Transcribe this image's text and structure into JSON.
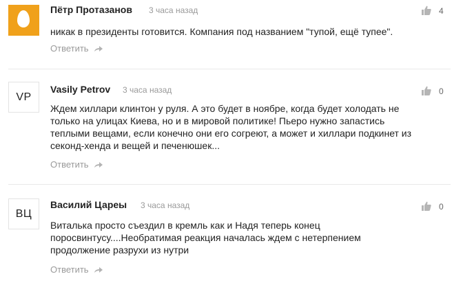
{
  "comments": [
    {
      "author": "Пётр Протазанов",
      "time": "3 часа назад",
      "text": "никак в президенты готовится. Компания под названием \"тупой, ещё тупее\".",
      "reply_label": "Ответить",
      "likes": "4",
      "avatar_type": "egg",
      "avatar_color": "#f0a11b"
    },
    {
      "author": "Vasily Petrov",
      "time": "3 часа назад",
      "text": "Ждем хиллари клинтон у руля. А это будет в ноябре, когда будет холодать не только на улицах Киева, но и в мировой политике! Пьеро нужно запастись теплыми вещами, если конечно они его согреют, а может и хиллари подкинет из секонд-хенда и вещей и печенюшек...",
      "reply_label": "Ответить",
      "likes": "0",
      "avatar_initials": "VP"
    },
    {
      "author": "Василий Цареы",
      "time": "3 часа назад",
      "text": "Виталька просто съездил в кремль как и Надя теперь конец поросвинтусу....Необратимая реакция началась ждем с нетерпением продолжение разрухи из нутри",
      "reply_label": "Ответить",
      "likes": "0",
      "avatar_initials": "ВЦ"
    }
  ],
  "colors": {
    "author": "#222222",
    "meta": "#999999",
    "divider": "#e8e8e8"
  }
}
